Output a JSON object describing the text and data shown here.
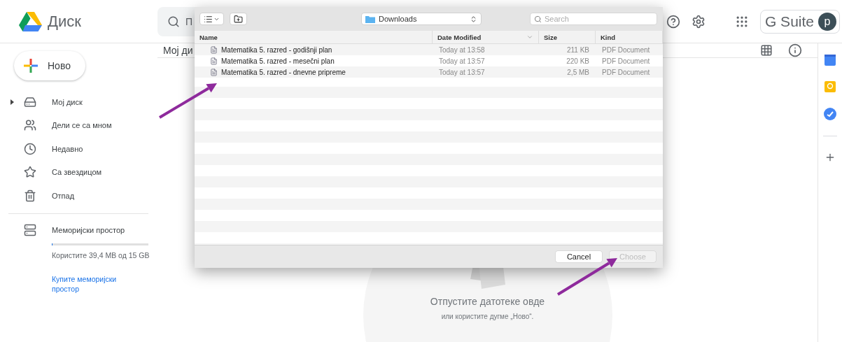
{
  "app": {
    "name": "Диск"
  },
  "search": {
    "placeholder": "П"
  },
  "account": {
    "brand": "G Suite",
    "avatar_letter": "p"
  },
  "new_button": {
    "label": "Ново"
  },
  "nav": [
    {
      "label": "Мој диск",
      "expandable": true
    },
    {
      "label": "Дели се са мном",
      "expandable": false
    },
    {
      "label": "Недавно",
      "expandable": false
    },
    {
      "label": "Са звездицом",
      "expandable": false
    },
    {
      "label": "Отпад",
      "expandable": false
    }
  ],
  "storage": {
    "label": "Меморијски простор",
    "level": 0.003,
    "usage": "Користите 39,4 MB од 15 GB",
    "buy_link": "Купите меморијски простор"
  },
  "main": {
    "title": "Мој ди",
    "drop_title": "Отпустите датотеке овде",
    "drop_hint": "или користите дугме „Ново“."
  },
  "dialog": {
    "location": "Downloads",
    "search_placeholder": "Search",
    "columns": [
      {
        "label": "Name",
        "sorted": false
      },
      {
        "label": "Date Modified",
        "sorted": true
      },
      {
        "label": "Size",
        "sorted": false
      },
      {
        "label": "Kind",
        "sorted": false
      }
    ],
    "files": [
      {
        "name": "Matematika 5. razred - godišnji plan",
        "modified": "Today at 13:58",
        "size": "211 KB",
        "kind": "PDF Document"
      },
      {
        "name": "Matematika 5. razred - mesečni plan",
        "modified": "Today at 13:57",
        "size": "220 KB",
        "kind": "PDF Document"
      },
      {
        "name": "Matematika 5. razred - dnevne pripreme",
        "modified": "Today at 13:57",
        "size": "2,5 MB",
        "kind": "PDF Document"
      }
    ],
    "buttons": [
      {
        "label": "Cancel",
        "disabled": false
      },
      {
        "label": "Choose",
        "disabled": true
      }
    ]
  }
}
